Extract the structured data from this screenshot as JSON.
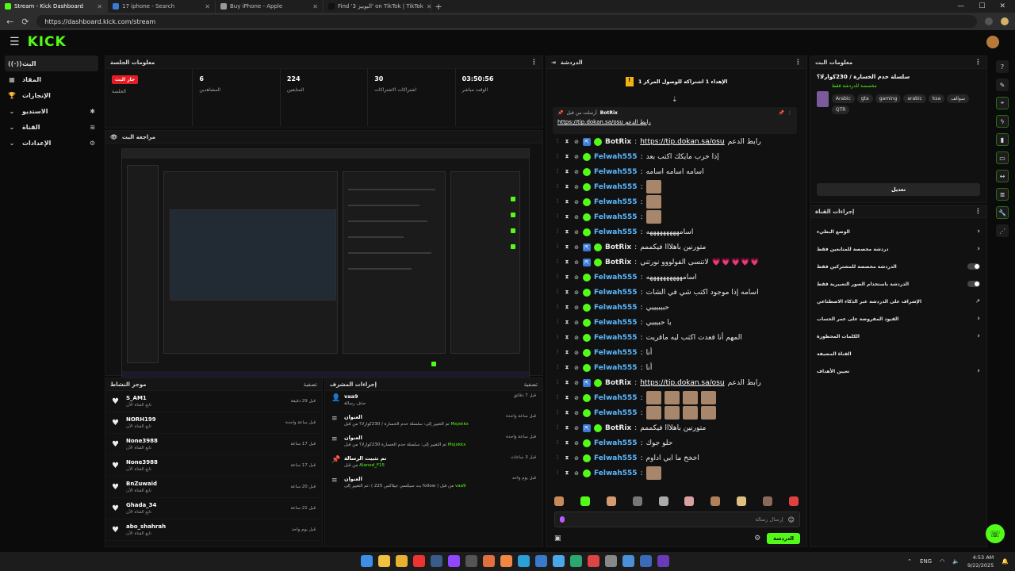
{
  "browser": {
    "tabs": [
      {
        "label": "Stream - Kick Dashboard",
        "color": "#53fc18",
        "active": true
      },
      {
        "label": "17 iphone - Search",
        "color": "#3b7bd6",
        "active": false
      },
      {
        "label": "Buy iPhone - Apple",
        "color": "#999999",
        "active": false
      },
      {
        "label": "Find 'البوبيز 3' on TikTok | TikTok",
        "color": "#111111",
        "active": false
      }
    ],
    "url": "https://dashboard.kick.com/stream"
  },
  "kick": {
    "logo": "KICK"
  },
  "leftnav": {
    "items": [
      {
        "label": "البث",
        "icon": "((·))",
        "active": true
      },
      {
        "label": "المقاد",
        "icon": "▦"
      },
      {
        "label": "الإنجازات",
        "icon": "🏆"
      },
      {
        "label": "الاستديو",
        "icon": "⌄",
        "right": "✱"
      },
      {
        "label": "القناة",
        "icon": "⌄",
        "right": "≋"
      },
      {
        "label": "الإعدادات",
        "icon": "⌄",
        "right": "⚙"
      }
    ]
  },
  "session": {
    "title": "معلومات الجلسة",
    "stats": [
      {
        "value": "جار البث",
        "label": "الجلسة",
        "badge": true
      },
      {
        "value": "6",
        "label": "المشاهدين"
      },
      {
        "value": "224",
        "label": "المتابعين"
      },
      {
        "value": "30",
        "label": "اشتراكات الاشتراكات"
      },
      {
        "value": "03:50:56",
        "label": "الوقت مباشر"
      }
    ]
  },
  "preview": {
    "title": "مراجعة البث"
  },
  "activity": {
    "title": "موجز النشاط",
    "filter": "تصفية",
    "items": [
      {
        "name": "S_AM1",
        "sub": "تابع القناة الآن",
        "time": "قبل 29 دقيقة"
      },
      {
        "name": "NORH199",
        "sub": "تابع القناة الآن",
        "time": "قبل ساعة واحدة"
      },
      {
        "name": "None3988",
        "sub": "تابع القناة الآن",
        "time": "قبل 17 ساعة"
      },
      {
        "name": "None3988",
        "sub": "تابع القناة الآن",
        "time": "قبل 17 ساعة"
      },
      {
        "name": "BnZuwaid",
        "sub": "تابع القناة الآن",
        "time": "قبل 20 ساعة"
      },
      {
        "name": "Ghada_34",
        "sub": "تابع القناة الآن",
        "time": "قبل 21 ساعة"
      },
      {
        "name": "abo_shahrah",
        "sub": "تابع القناة الآن",
        "time": "قبل يوم واحد"
      }
    ]
  },
  "modactions": {
    "title": "إجراءات المشرف",
    "filter": "تصفية",
    "items": [
      {
        "icon": "👤",
        "t1": "vaa9",
        "t2": "حذف رسالة",
        "hl": "",
        "time": "قبل 7 دقائق"
      },
      {
        "icon": "≡",
        "t1": "العنوان",
        "t2": "تم التغيير إلى: سلسلة حدم الخسارة / 230كوارلا؟ من قبل",
        "hl": "Mxjxkkx",
        "time": "قبل ساعة واحدة"
      },
      {
        "icon": "≡",
        "t1": "العنوان",
        "t2": "تم التغيير إلى: سلسلة حدم الخسارة 230كوارلا؟ من قبل",
        "hl": "Mxjxkkx",
        "time": "قبل ساعة واحدة"
      },
      {
        "icon": "📌",
        "t1": "تم تثبيت الرسالة",
        "t2": "من قبل",
        "hl": "Alanod_F15",
        "time": "قبل 3 ساعات"
      },
      {
        "icon": "≡",
        "t1": "العنوان",
        "t2": "تم التغيير إلى: ( بث سيكسي جيلاكس 225 follow ) من قبل",
        "hl": "vaa9",
        "time": "قبل يوم واحد"
      }
    ]
  },
  "chat": {
    "title": "الدردشة",
    "goal": "الإهداء 1 اشتراكه للوصول المركز 1",
    "pinned": {
      "from": "أرسلت من قبل",
      "user": "BotRix",
      "text": "رابط الدعم",
      "url": "https://tip.dokan.sa/osu"
    },
    "messages": [
      {
        "user": "BotRix",
        "bot": true,
        "text": "رابط الدعم ",
        "link": "https://tip.dokan.sa/osu"
      },
      {
        "user": "Felwah555",
        "text": "إذا خرب مايكك اكتب بعد"
      },
      {
        "user": "Felwah555",
        "text": "اسامه اسامه اسامه"
      },
      {
        "user": "Felwah555",
        "text": "",
        "emotes": 1
      },
      {
        "user": "Felwah555",
        "text": "",
        "emotes": 1
      },
      {
        "user": "Felwah555",
        "text": "",
        "emotes": 1
      },
      {
        "user": "Felwah555",
        "text": "اسامهههههههههه"
      },
      {
        "user": "BotRix",
        "bot": true,
        "text": "متورنين باهلااا فيكممم"
      },
      {
        "user": "BotRix",
        "bot": true,
        "text": "لاتنسى الفولووو نورتني",
        "hearts": "💗💗💗💗💗"
      },
      {
        "user": "Felwah555",
        "text": "اسامههههههههههه"
      },
      {
        "user": "Felwah555",
        "text": "اسامه إذا موجود اكتب شي في الشات"
      },
      {
        "user": "Felwah555",
        "text": "حبيبيييي"
      },
      {
        "user": "Felwah555",
        "text": "يا حبيبيي"
      },
      {
        "user": "Felwah555",
        "text": "المهم أنا قعدت اكتب ليه ماقريت"
      },
      {
        "user": "Felwah555",
        "text": "أنا"
      },
      {
        "user": "Felwah555",
        "text": "أنا"
      },
      {
        "user": "BotRix",
        "bot": true,
        "text": "رابط الدعم ",
        "link": "https://tip.dokan.sa/osu"
      },
      {
        "user": "Felwah555",
        "text": "",
        "emotes": 4
      },
      {
        "user": "Felwah555",
        "text": "",
        "emotes": 4
      },
      {
        "user": "BotRix",
        "bot": true,
        "text": "متورنين باهلااا فيكممم"
      },
      {
        "user": "Felwah555",
        "text": "حلو جوك"
      },
      {
        "user": "Felwah555",
        "text": "اخخخ ما ابي اداوم"
      },
      {
        "user": "Felwah555",
        "text": "",
        "emotes": 1
      }
    ],
    "input_placeholder": "إرسال رسالة",
    "send_label": "الدردشة"
  },
  "streaminfo": {
    "title": "معلومات البث",
    "stream_title": "سلسلة حدم الخسارة / 230كوارلا؟",
    "category": "مخصصة للدردشة فقط",
    "tags": [
      "QTR",
      "سوالف",
      "ksa",
      "arabic",
      "gaming",
      "gta",
      "Arabic"
    ],
    "edit_label": "تعديل"
  },
  "channelactions": {
    "title": "إجراءات القناة",
    "rows": [
      {
        "label": "الوضع البطيء",
        "control": "arrow"
      },
      {
        "label": "دردشة مخصصة للمتابعين فقط",
        "control": "arrow"
      },
      {
        "label": "الدردشة مخصصة للمشتركين فقط",
        "control": "toggle"
      },
      {
        "label": "الدردشة باستخدام الصور التعبيرية فقط",
        "control": "toggle"
      },
      {
        "label": "الإشراف على الدردشة عبر الذكاء الاصطناعي",
        "control": "ext"
      },
      {
        "label": "القيود المفروضة على عمر الحساب",
        "control": "arrow"
      },
      {
        "label": "الكلمات المحظورة",
        "control": "arrow"
      },
      {
        "label": "القناة المضيفة",
        "control": "none"
      },
      {
        "label": "تعيين الأهداف",
        "control": "arrow"
      }
    ]
  },
  "taskbar": {
    "lang": "ENG",
    "time": "4:53 AM",
    "date": "9/22/2025"
  }
}
